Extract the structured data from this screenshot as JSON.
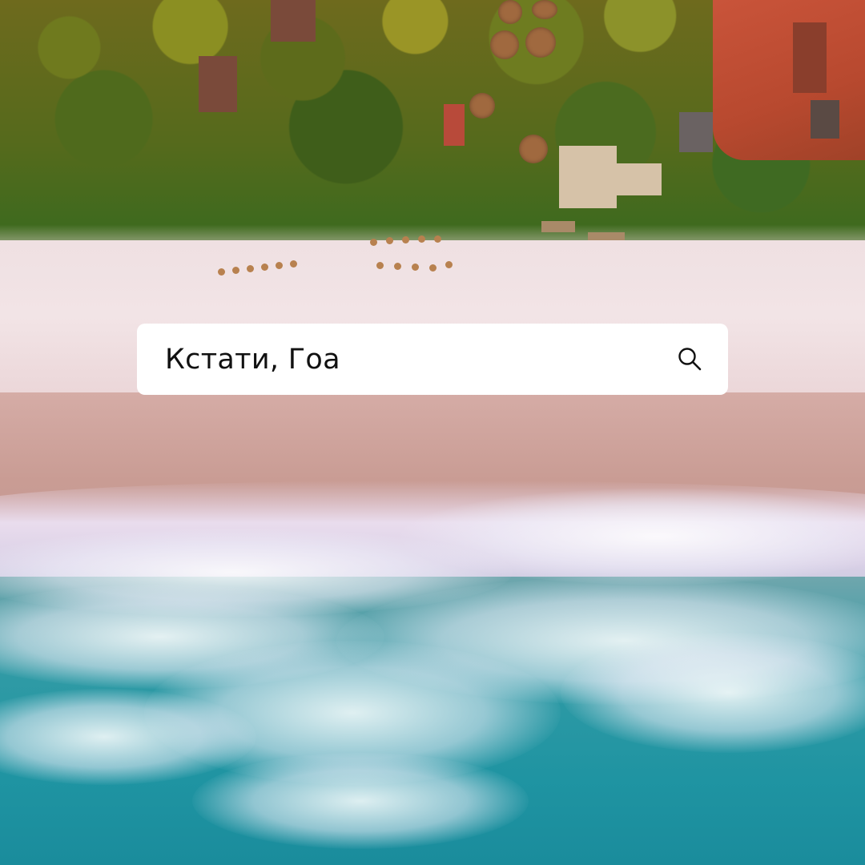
{
  "search": {
    "query": "Кстати, Гоа",
    "icon": "magnifier-icon"
  },
  "colors": {
    "search_bg": "#ffffff",
    "search_text": "#111111",
    "sea": "#1f94a2",
    "sand": "#efe0e2",
    "foliage": "#556a1c"
  }
}
